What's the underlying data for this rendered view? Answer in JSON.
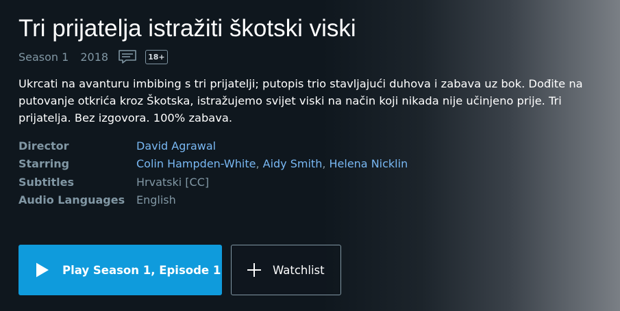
{
  "header": {
    "title": "Tri prijatelja istražiti škotski viski",
    "season": "Season 1",
    "year": "2018",
    "rating": "18+"
  },
  "icons": {
    "subtitles": "subtitles-icon",
    "play": "play-icon",
    "add": "plus-icon"
  },
  "synopsis": "Ukrcati na avanturu imbibing s tri prijatelji; putopis trio stavljajući duhova i zabava uz bok. Dođite na putovanje otkrića kroz Škotska, istražujemo svijet viski na način koji nikada nije učinjeno prije. Tri prijatelja. Bez izgovora. 100% zabava.",
  "details": {
    "director_label": "Director",
    "director": "David Agrawal",
    "starring_label": "Starring",
    "starring": [
      "Colin Hampden-White",
      "Aidy Smith",
      "Helena Nicklin"
    ],
    "separator": ", ",
    "subtitles_label": "Subtitles",
    "subtitles": "Hrvatski [CC]",
    "audio_label": "Audio Languages",
    "audio": "English"
  },
  "actions": {
    "play_label": "Play Season 1, Episode 1",
    "watchlist_label": "Watchlist"
  },
  "colors": {
    "background": "#0f171e",
    "muted_text": "#8197a4",
    "link": "#79b8f3",
    "play_button": "#0f9bdc"
  }
}
